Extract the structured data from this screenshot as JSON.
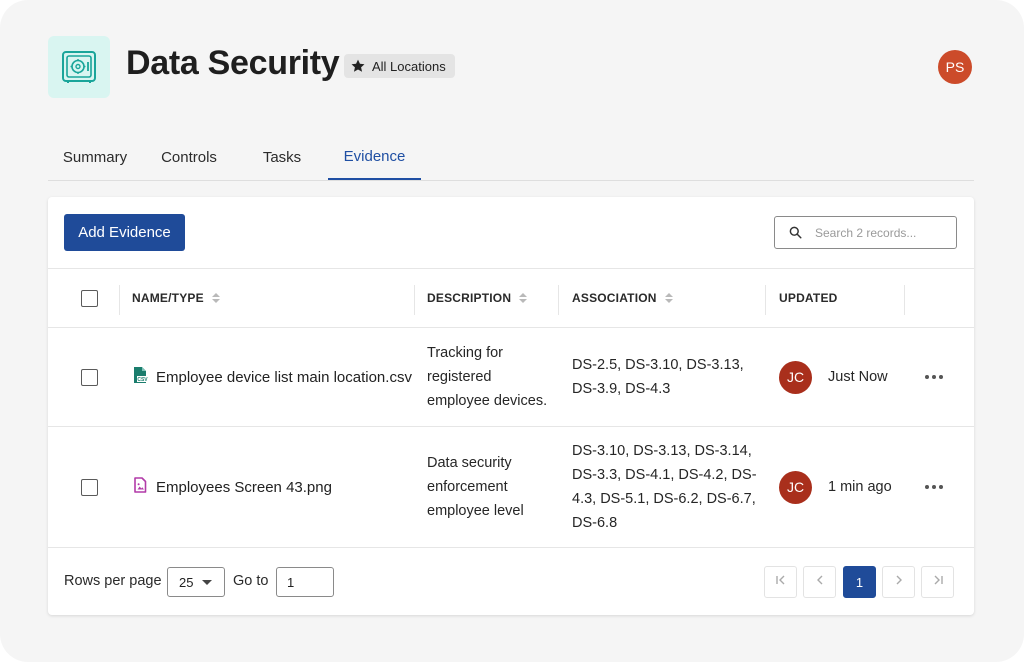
{
  "header": {
    "title": "Data Security",
    "location_badge": "All Locations",
    "user_initials": "PS"
  },
  "tabs": [
    {
      "label": "Summary",
      "active": false
    },
    {
      "label": "Controls",
      "active": false
    },
    {
      "label": "Tasks",
      "active": false
    },
    {
      "label": "Evidence",
      "active": true
    }
  ],
  "toolbar": {
    "add_button": "Add Evidence",
    "search_placeholder": "Search 2 records..."
  },
  "table": {
    "columns": [
      "NAME/TYPE",
      "DESCRIPTION",
      "ASSOCIATION",
      "UPDATED"
    ],
    "rows": [
      {
        "file_type": "csv",
        "file_icon": "csv-file-icon",
        "name": "Employee device list main location.csv",
        "description": [
          "Tracking for",
          "registered",
          "employee devices."
        ],
        "association": [
          "DS-2.5, DS-3.10, DS-3.13,",
          "DS-3.9, DS-4.3"
        ],
        "updated_by": "JC",
        "updated": "Just Now"
      },
      {
        "file_type": "png",
        "file_icon": "image-file-icon",
        "name": "Employees Screen 43.png",
        "description": [
          "Data security",
          "enforcement",
          "employee level"
        ],
        "association": [
          "DS-3.10, DS-3.13, DS-3.14,",
          "DS-3.3, DS-4.1, DS-4.2, DS-",
          "4.3, DS-5.1, DS-6.2, DS-6.7,",
          "DS-6.8"
        ],
        "updated_by": "JC",
        "updated": "1 min ago"
      }
    ]
  },
  "pagination": {
    "rows_per_page_label": "Rows per page",
    "rows_per_page": "25",
    "goto_label": "Go to",
    "goto_value": "1",
    "current_page": "1"
  },
  "colors": {
    "primary": "#1f4b99",
    "active_tab": "#1f4fa3",
    "avatar_top": "#cc4b2a",
    "avatar_row": "#a92f1c",
    "app_icon_bg": "#d9f5f1",
    "csv_icon": "#1a7d6d",
    "png_icon": "#b23aa8"
  }
}
